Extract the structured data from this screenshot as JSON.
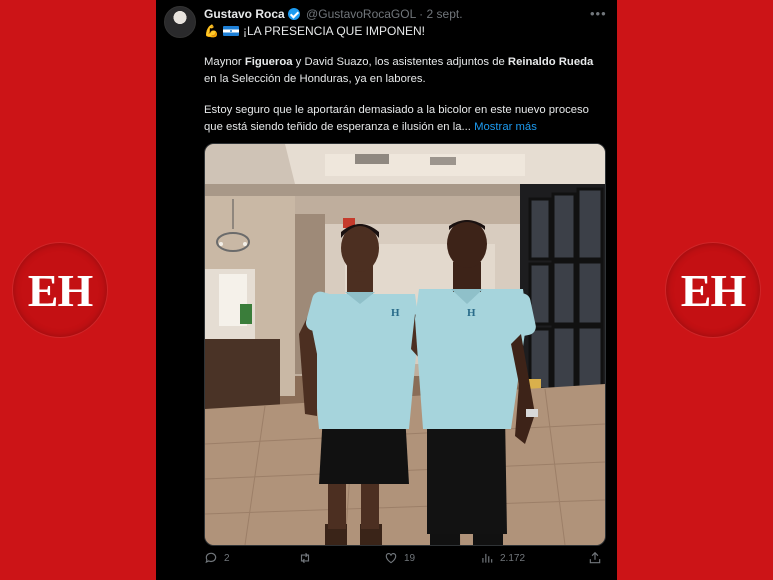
{
  "branding": {
    "logo_text": "EH"
  },
  "tweet": {
    "author_name": "Gustavo Roca",
    "handle": "@GustavoRocaGOL",
    "separator": "·",
    "date": "2 sept.",
    "more_icon": "more-icon",
    "headline": "¡LA PRESENCIA QUE IMPONEN!",
    "paragraph1": {
      "t1": "Maynor ",
      "b1": "Figueroa",
      "t2": " y David Suazo, los asistentes adjuntos de ",
      "b2": "Reinaldo Rueda",
      "t3": " en la Selección de Honduras, ya en labores."
    },
    "paragraph2": "Estoy seguro que le aportarán demasiado a la bicolor en este nuevo proceso que está siendo teñido de esperanza e ilusión en la...",
    "show_more": "Mostrar más",
    "actions": {
      "replies": "2",
      "retweets": "",
      "likes": "19",
      "views": "2.172"
    }
  },
  "colors": {
    "background_red": "#cc1417",
    "link_blue": "#1d9bf0",
    "muted": "#71767b",
    "shirt": "#a6d4dc"
  }
}
